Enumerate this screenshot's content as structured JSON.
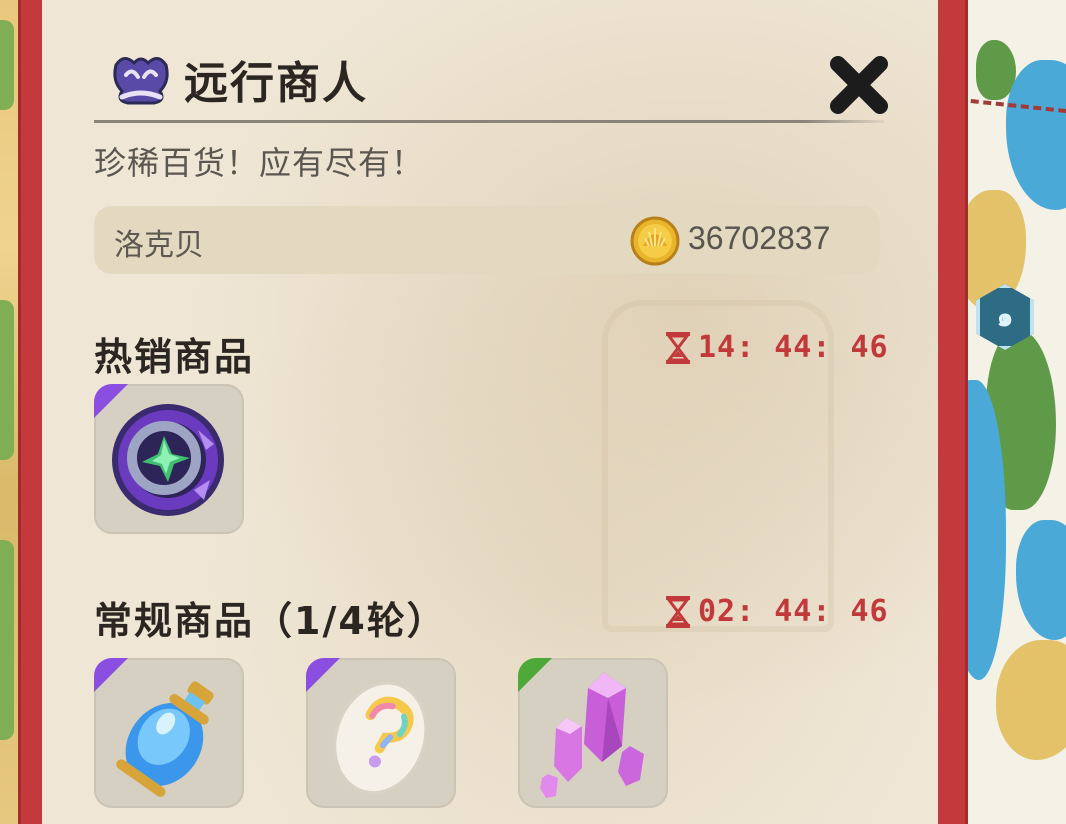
{
  "header": {
    "title": "远行商人",
    "subtitle": "珍稀百货！应有尽有！",
    "merchant_icon": "merchant-hat-icon",
    "close_icon": "close-icon"
  },
  "player": {
    "name": "洛克贝",
    "currency_icon": "gold-shell-coin-icon",
    "currency": "36702837"
  },
  "hot_section": {
    "title": "热销商品",
    "timer": "14: 44: 46",
    "timer_icon": "hourglass-icon",
    "items": [
      {
        "icon": "purple-ring-orb-icon",
        "rarity_color": "#8a4ee0"
      }
    ]
  },
  "regular_section": {
    "title": "常规商品（1/4轮）",
    "timer": "02: 44: 46",
    "timer_icon": "hourglass-icon",
    "items": [
      {
        "icon": "blue-potion-bottle-icon",
        "rarity_color": "#8a4ee0"
      },
      {
        "icon": "rainbow-question-egg-icon",
        "rarity_color": "#8a4ee0"
      },
      {
        "icon": "pink-crystal-icon",
        "rarity_color": "#4fa83a"
      }
    ]
  },
  "colors": {
    "frame": "#c43a3c",
    "panel": "#efe6d5",
    "timer_text": "#c2393c",
    "title_text": "#2b2622"
  }
}
